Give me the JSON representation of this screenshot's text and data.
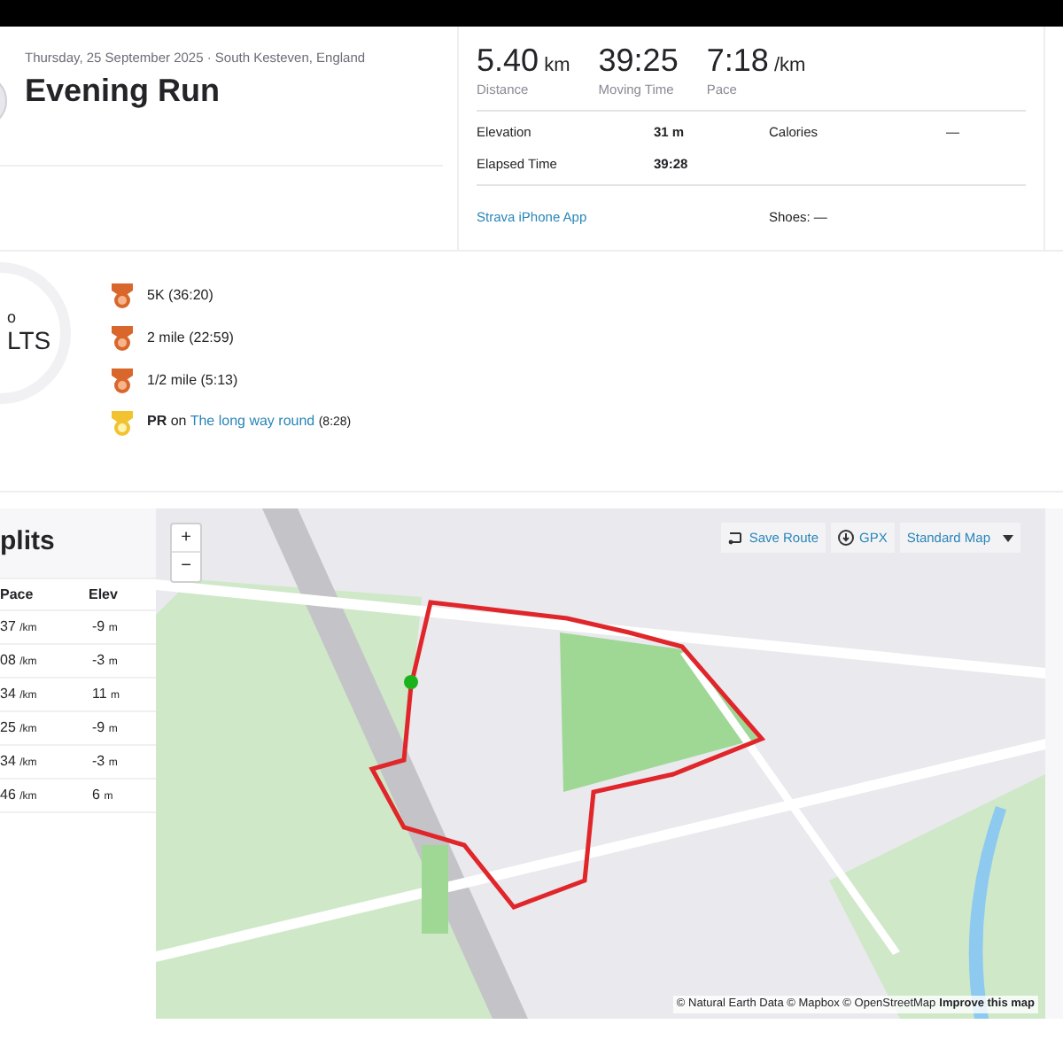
{
  "activity": {
    "date_location": "Thursday, 25 September 2025 · South Kesteven, England",
    "title": "Evening Run"
  },
  "stats": [
    {
      "value": "5.40",
      "unit": "km",
      "label": "Distance"
    },
    {
      "value": "39:25",
      "label": "Moving Time"
    },
    {
      "value": "7:18",
      "unit": "/km",
      "label": "Pace"
    }
  ],
  "details": [
    {
      "label": "Elevation",
      "value": "31 m",
      "label_2": "Calories",
      "value_2": "—"
    },
    {
      "label": "Elapsed Time",
      "value": "39:28"
    }
  ],
  "device": "Strava iPhone App",
  "shoes": "Shoes: —",
  "results_badge": {
    "count": "o",
    "label": "LTS"
  },
  "achievements": [
    {
      "kind": "medal",
      "text": "5K",
      "time": "(36:20)"
    },
    {
      "kind": "medal",
      "text": "2 mile",
      "time": "(22:59)"
    },
    {
      "kind": "medal",
      "text": "1/2 mile",
      "time": "(5:13)"
    },
    {
      "kind": "pr",
      "prefix": "PR",
      "joiner": "on",
      "segment": "The long way round",
      "time": "(8:28)"
    }
  ],
  "splits": {
    "title": "plits",
    "columns": [
      "Pace",
      "Elev"
    ],
    "rows": [
      {
        "pace": "37",
        "pace_unit": "/km",
        "elev": "-9",
        "elev_unit": "m"
      },
      {
        "pace": "08",
        "pace_unit": "/km",
        "elev": "-3",
        "elev_unit": "m"
      },
      {
        "pace": "34",
        "pace_unit": "/km",
        "elev": "11",
        "elev_unit": "m"
      },
      {
        "pace": "25",
        "pace_unit": "/km",
        "elev": "-9",
        "elev_unit": "m"
      },
      {
        "pace": "34",
        "pace_unit": "/km",
        "elev": "-3",
        "elev_unit": "m"
      },
      {
        "pace": "46",
        "pace_unit": "/km",
        "elev": "6",
        "elev_unit": "m"
      }
    ]
  },
  "map": {
    "zoom_in": "+",
    "zoom_out": "−",
    "actions": [
      {
        "kind": "save",
        "label": "Save Route"
      },
      {
        "kind": "gpx",
        "label": "GPX"
      },
      {
        "kind": "style",
        "label": "Standard Map"
      }
    ],
    "attribution": "© Natural Earth Data © Mapbox © OpenStreetMap",
    "improve": "Improve this map"
  }
}
